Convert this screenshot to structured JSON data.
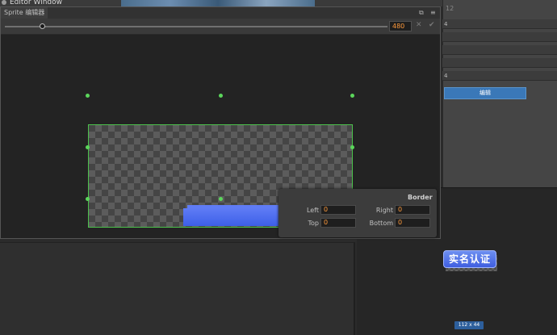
{
  "background": {
    "title": "Editor Window",
    "right_panel_label": "12",
    "right_panel_rows": [
      "4",
      "",
      "",
      "",
      "4",
      ""
    ],
    "edit_button_label": "编辑"
  },
  "preview": {
    "badge_text": "实名认证",
    "size_label": "112 x 44"
  },
  "sprite_window": {
    "tab_title": "Sprite 编辑器",
    "restore_icon": "⧉",
    "menu_icon": "≡",
    "zoom": {
      "value": "480",
      "slider_fraction": 0.1
    },
    "clear_icon": "✕",
    "confirm_icon": "✔"
  },
  "border_panel": {
    "title": "Border",
    "left_label": "Left",
    "left_value": "0",
    "right_label": "Right",
    "right_value": "0",
    "top_label": "Top",
    "top_value": "0",
    "bottom_label": "Bottom",
    "bottom_value": "0"
  },
  "colors": {
    "accent": "#ff9a3c",
    "selection": "#4cc24c",
    "button_blue": "#3a78b8"
  }
}
